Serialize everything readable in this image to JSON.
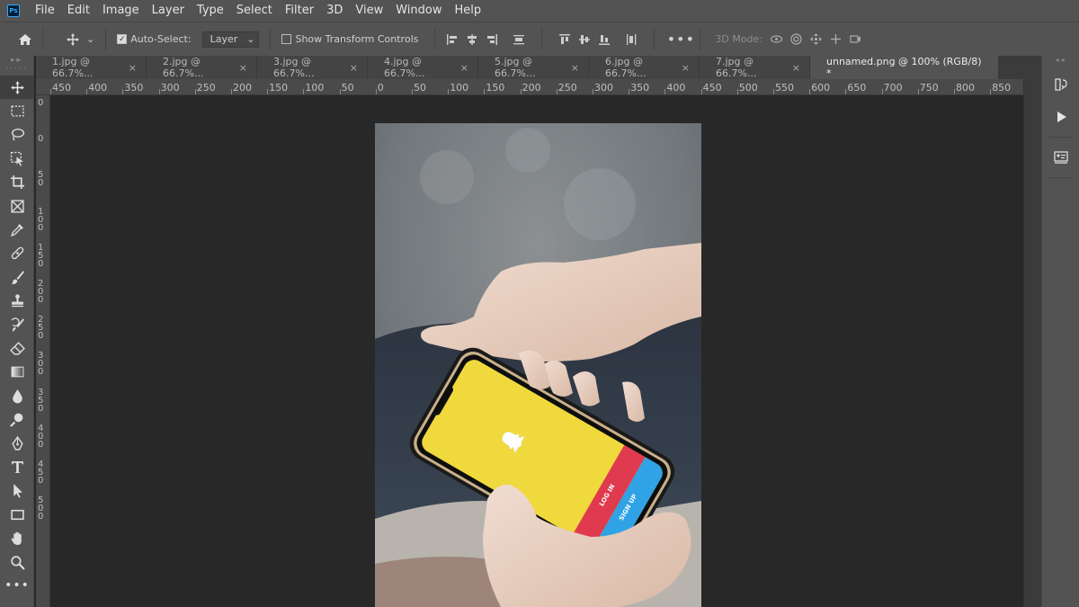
{
  "app": {
    "logo_text": "Ps"
  },
  "menu": [
    "File",
    "Edit",
    "Image",
    "Layer",
    "Type",
    "Select",
    "Filter",
    "3D",
    "View",
    "Window",
    "Help"
  ],
  "options": {
    "auto_select_label": "Auto-Select:",
    "auto_select_checked": true,
    "layer_dropdown": "Layer",
    "show_transform_label": "Show Transform Controls",
    "show_transform_checked": false,
    "mode_3d_label": "3D Mode:"
  },
  "tabs": [
    {
      "label": "1.jpg @ 66.7%...",
      "active": false
    },
    {
      "label": "2.jpg @ 66.7%...",
      "active": false
    },
    {
      "label": "3.jpg @ 66.7%...",
      "active": false
    },
    {
      "label": "4.jpg @ 66.7%...",
      "active": false
    },
    {
      "label": "5.jpg @ 66.7%...",
      "active": false
    },
    {
      "label": "6.jpg @ 66.7%...",
      "active": false
    },
    {
      "label": "7.jpg @ 66.7%...",
      "active": false
    },
    {
      "label": "unnamed.png @ 100% (RGB/8) *",
      "active": true
    }
  ],
  "ruler": {
    "horizontal": [
      "450",
      "400",
      "350",
      "300",
      "250",
      "200",
      "150",
      "100",
      "50",
      "0",
      "50",
      "100",
      "150",
      "200",
      "250",
      "300",
      "350",
      "400",
      "450",
      "500",
      "550",
      "600",
      "650",
      "700",
      "750",
      "800",
      "850"
    ],
    "vertical": [
      "0",
      "0",
      "5 0",
      "1 0 0",
      "1 5 0",
      "2 0 0",
      "2 5 0",
      "3 0 0",
      "3 5 0",
      "4 0 0",
      "4 5 0",
      "5 0 0"
    ]
  },
  "tools": [
    "move-tool",
    "marquee-tool",
    "lasso-tool",
    "object-select-tool",
    "crop-tool",
    "frame-tool",
    "eyedropper-tool",
    "healing-brush-tool",
    "brush-tool",
    "clone-stamp-tool",
    "history-brush-tool",
    "eraser-tool",
    "gradient-tool",
    "blur-tool",
    "dodge-tool",
    "pen-tool",
    "type-tool",
    "path-select-tool",
    "rectangle-tool",
    "hand-tool",
    "zoom-tool",
    "more-tools"
  ],
  "phone_screen": {
    "login_label": "LOG IN",
    "signup_label": "SIGN UP",
    "background": "#f0d93c",
    "login_color": "#e03a4e",
    "signup_color": "#2fa3e6"
  },
  "colors": {
    "panel": "#535353",
    "workspace": "#282828",
    "accent": "#31a8ff"
  }
}
